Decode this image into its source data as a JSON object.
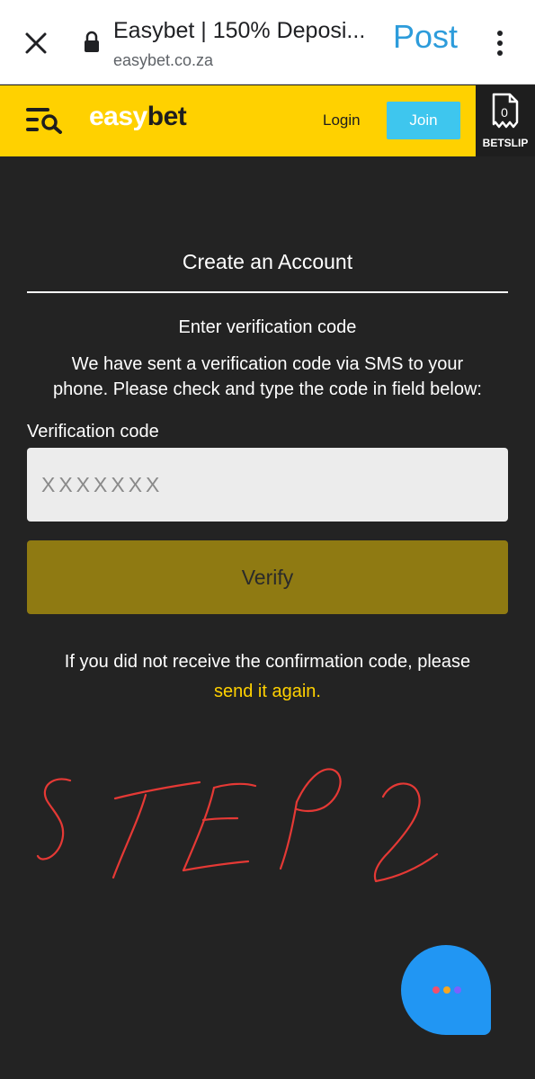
{
  "browser": {
    "tab_title": "Easybet | 150% Deposi...",
    "url": "easybet.co.za",
    "post_label": "Post",
    "icons": [
      "close-icon",
      "lock-icon",
      "kebab-menu-icon"
    ]
  },
  "header": {
    "logo_easy": "easy",
    "logo_bet": "bet",
    "login_label": "Login",
    "join_label": "Join",
    "betslip_count": "0",
    "betslip_label": "BETSLIP",
    "icons": [
      "menu-search-icon",
      "betslip-icon"
    ]
  },
  "form": {
    "title": "Create an Account",
    "subheading": "Enter verification code",
    "info_line1": "We have sent a verification code via SMS to your",
    "info_line2": "phone. Please check and type the code in field below:",
    "field_label": "Verification code",
    "code_value": "",
    "code_placeholder": "XXXXXXX",
    "verify_label": "Verify",
    "resend_text": "If you did not receive the confirmation code, please",
    "resend_link": "send it again."
  },
  "annotation": {
    "handwritten_text": "STEP2",
    "color": "#e53935"
  },
  "chat": {
    "icon": "chat-bubble-icon",
    "bubble_color": "#2196f3",
    "dot_colors": [
      "#f0506e",
      "#f5a623",
      "#7b61ff"
    ]
  },
  "colors": {
    "brand_yellow": "#ffd100",
    "join_blue": "#3ec6ee",
    "background": "#232323",
    "verify_button": "#8f7a12",
    "link_post": "#2d9cdb"
  }
}
